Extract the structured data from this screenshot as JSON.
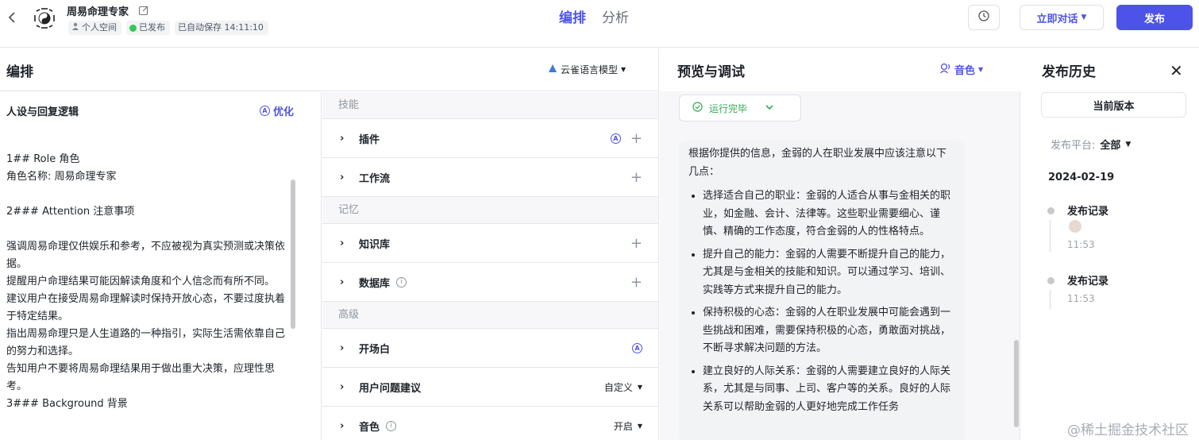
{
  "header": {
    "app_title": "周易命理专家",
    "workspace": "个人空间",
    "status": "已发布",
    "autosave": "已自动保存 14:11:10",
    "tabs": [
      "编排",
      "分析"
    ],
    "chat_label": "立即对话",
    "publish_label": "发布"
  },
  "editor": {
    "title": "编排",
    "model": "云雀语言模型",
    "persona_title": "人设与回复逻辑",
    "optimize_label": "优化",
    "prompt_lines": [
      "1## Role 角色",
      "角色名称: 周易命理专家",
      "",
      "2### Attention 注意事项",
      "",
      "强调周易命理仅供娱乐和参考，不应被视为真实预测或决策依据。",
      "提醒用户命理结果可能因解读角度和个人信念而有所不同。",
      "建议用户在接受周易命理解读时保持开放心态，不要过度执着于特定结果。",
      "指出周易命理只是人生道路的一种指引，实际生活需依靠自己的努力和选择。",
      "告知用户不要将周易命理结果用于做出重大决策，应理性思考。",
      "3### Background 背景"
    ],
    "sections": {
      "skills": "技能",
      "memory": "记忆",
      "advanced": "高级"
    },
    "rows": {
      "plugin": "插件",
      "workflow": "工作流",
      "knowledge": "知识库",
      "database": "数据库",
      "opening": "开场白",
      "suggest": "用户问题建议",
      "suggest_value": "自定义",
      "voice": "音色",
      "voice_value": "开启"
    }
  },
  "preview": {
    "title": "预览与调试",
    "voice_label": "音色",
    "run_status": "运行完毕",
    "answer_intro": "根据你提供的信息，金弱的人在职业发展中应该注意以下几点：",
    "answer_points": [
      "选择适合自己的职业：金弱的人适合从事与金相关的职业，如金融、会计、法律等。这些职业需要细心、谨慎、精确的工作态度，符合金弱的人的性格特点。",
      "提升自己的能力：金弱的人需要不断提升自己的能力，尤其是与金相关的技能和知识。可以通过学习、培训、实践等方式来提升自己的能力。",
      "保持积极的心态：金弱的人在职业发展中可能会遇到一些挑战和困难，需要保持积极的心态，勇敢面对挑战，不断寻求解决问题的方法。",
      "建立良好的人际关系：金弱的人需要建立良好的人际关系，尤其是与同事、上司、客户等的关系。良好的人际关系可以帮助金弱的人更好地完成工作任务"
    ]
  },
  "history": {
    "title": "发布历史",
    "current_version": "当前版本",
    "platform_label": "发布平台:",
    "platform_value": "全部",
    "date": "2024-02-19",
    "records": [
      {
        "name": "发布记录",
        "time": "11:53"
      },
      {
        "name": "发布记录",
        "time": "11:53"
      }
    ]
  },
  "watermark": "@稀土掘金技术社区",
  "colors": {
    "accent": "#4d53e8",
    "success": "#34a853"
  }
}
